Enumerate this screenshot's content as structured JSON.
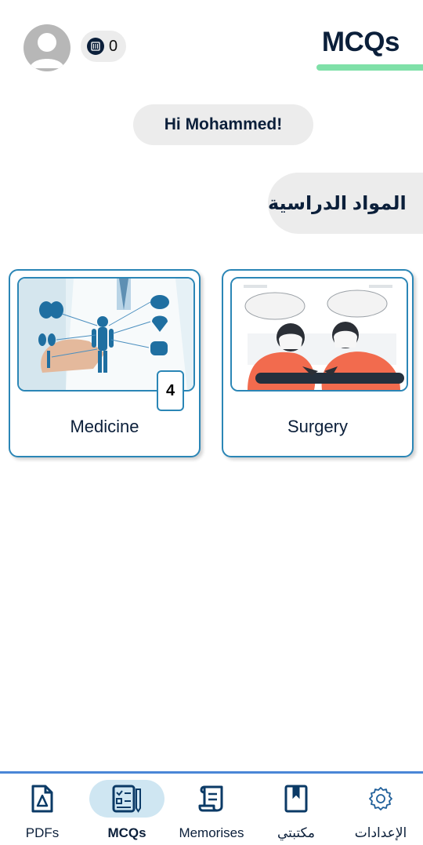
{
  "header": {
    "app_title": "MCQs",
    "coin_count": "0",
    "accent_color": "#7fe0a8"
  },
  "greeting": "Hi Mohammed!",
  "section_title": "المواد الدراسية",
  "subjects": [
    {
      "label": "Medicine",
      "badge": "4",
      "icon": "medical-body-illustration"
    },
    {
      "label": "Surgery",
      "icon": "surgery-illustration"
    }
  ],
  "bottom_nav": {
    "active_tab": "MCQs",
    "active_color": "#cfe6f2",
    "items": [
      {
        "label": "PDFs",
        "icon": "pdf-icon"
      },
      {
        "label": "MCQs",
        "icon": "checklist-icon"
      },
      {
        "label": "Memorises",
        "icon": "scroll-icon"
      },
      {
        "label": "مكتبتي",
        "icon": "bookmark-book-icon"
      },
      {
        "label": "الإعدادات",
        "icon": "gear-icon"
      }
    ]
  }
}
